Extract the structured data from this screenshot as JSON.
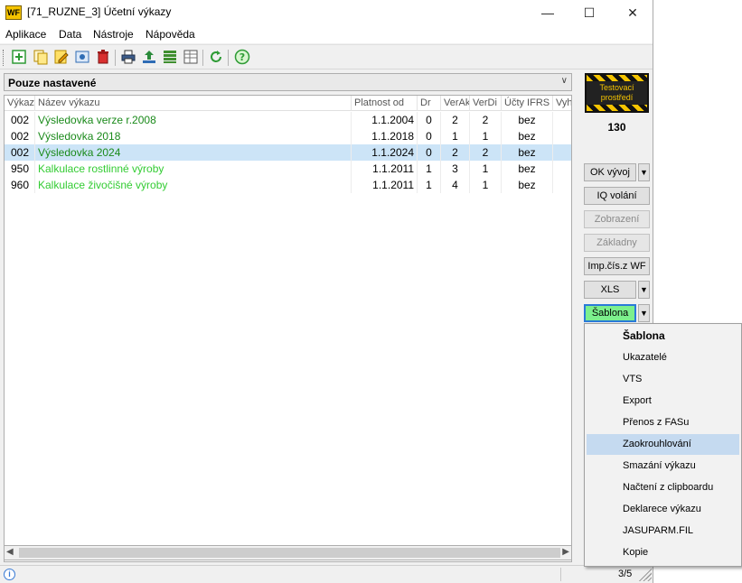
{
  "window": {
    "logo_text": "WF",
    "title": "[71_RUZNE_3] Účetní výkazy",
    "minimize_glyph": "—",
    "maximize_glyph": "☐",
    "close_glyph": "✕"
  },
  "menubar": {
    "items": [
      "Aplikace",
      "Data",
      "Nástroje",
      "Nápověda"
    ]
  },
  "toolbar": {
    "icons": [
      "add-icon",
      "copy-icon",
      "edit-icon",
      "view-icon",
      "delete-icon",
      "print-icon",
      "export-icon",
      "list-icon",
      "table-icon",
      "refresh-icon",
      "help-icon"
    ],
    "colors": {
      "add": "#2e9b35",
      "copy": "#d6a300",
      "edit": "#e0b800",
      "view": "#2f6db5",
      "delete": "#c62828",
      "print": "#3b5b8a",
      "export": "#2a8a3a",
      "list": "#3f8f2f",
      "table": "#6b6b6b",
      "refresh": "#2e9b35",
      "help": "#2e9b35"
    }
  },
  "filter": {
    "value": "Pouze nastavené",
    "arrow": "∨"
  },
  "grid": {
    "headers": [
      "Výkaz",
      "Název výkazu",
      "Platnost od",
      "Dr",
      "VerAk",
      "VerDi",
      "Účty IFRS",
      "Vyh"
    ],
    "rows": [
      {
        "num": "002",
        "name": "Výsledovka verze r.2008",
        "date": "1.1.2004",
        "dr": "0",
        "verak": "2",
        "verdi": "2",
        "ifrs": "bez",
        "color": "#1a8a1a",
        "selected": false
      },
      {
        "num": "002",
        "name": "Výsledovka 2018",
        "date": "1.1.2018",
        "dr": "0",
        "verak": "1",
        "verdi": "1",
        "ifrs": "bez",
        "color": "#1a8a1a",
        "selected": false
      },
      {
        "num": "002",
        "name": "Výsledovka 2024",
        "date": "1.1.2024",
        "dr": "0",
        "verak": "2",
        "verdi": "2",
        "ifrs": "bez",
        "color": "#1a8a1a",
        "selected": true
      },
      {
        "num": "950",
        "name": "Kalkulace rostlinné výroby",
        "date": "1.1.2011",
        "dr": "1",
        "verak": "3",
        "verdi": "1",
        "ifrs": "bez",
        "color": "#33cc33",
        "selected": false
      },
      {
        "num": "960",
        "name": "Kalkulace živočišné výroby",
        "date": "1.1.2011",
        "dr": "1",
        "verak": "4",
        "verdi": "1",
        "ifrs": "bez",
        "color": "#33cc33",
        "selected": false
      }
    ]
  },
  "statusbar": {
    "info_glyph": "i",
    "page": "3/5"
  },
  "env": {
    "line1": "Testovací",
    "line2": "prostředí",
    "count": "130"
  },
  "side_buttons": {
    "ok_vyvoj": "OK vývoj",
    "iq_volani": "IQ volání",
    "zobrazeni": "Zobrazení",
    "zakladny": "Základny",
    "imp_cis": "Imp.čís.z WF",
    "xls": "XLS",
    "sablona": "Šablona",
    "arrow": "▼"
  },
  "popup": {
    "items": [
      "Šablona",
      "Ukazatelé",
      "VTS",
      "Export",
      "Přenos z FASu",
      "Zaokrouhlování",
      "Smazání výkazu",
      "Načtení z clipboardu",
      "Deklarece výkazu",
      "JASUPARM.FIL",
      "Kopie"
    ],
    "highlight_color": "#c5daf0"
  }
}
